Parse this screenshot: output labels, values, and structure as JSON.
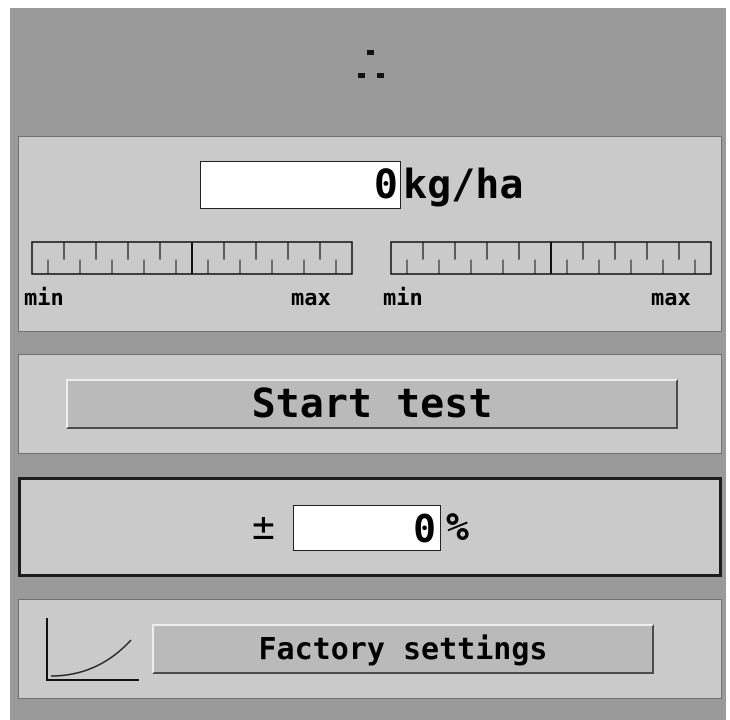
{
  "header": {
    "icon": "dots-icon"
  },
  "rate_panel": {
    "value": "0",
    "unit": "kg/ha",
    "left_bar": {
      "min_label": "min",
      "max_label": "max",
      "level": 0
    },
    "right_bar": {
      "min_label": "min",
      "max_label": "max",
      "level": 0
    }
  },
  "test_panel": {
    "start_label": "Start test"
  },
  "correction_panel": {
    "plusminus": "±",
    "value": "0",
    "unit": "%"
  },
  "footer_panel": {
    "icon": "curve-icon",
    "factory_label": "Factory settings"
  },
  "colors": {
    "background": "#999a99",
    "panel": "#c9cac9",
    "button": "#b9bab9",
    "field": "#ffffff"
  }
}
